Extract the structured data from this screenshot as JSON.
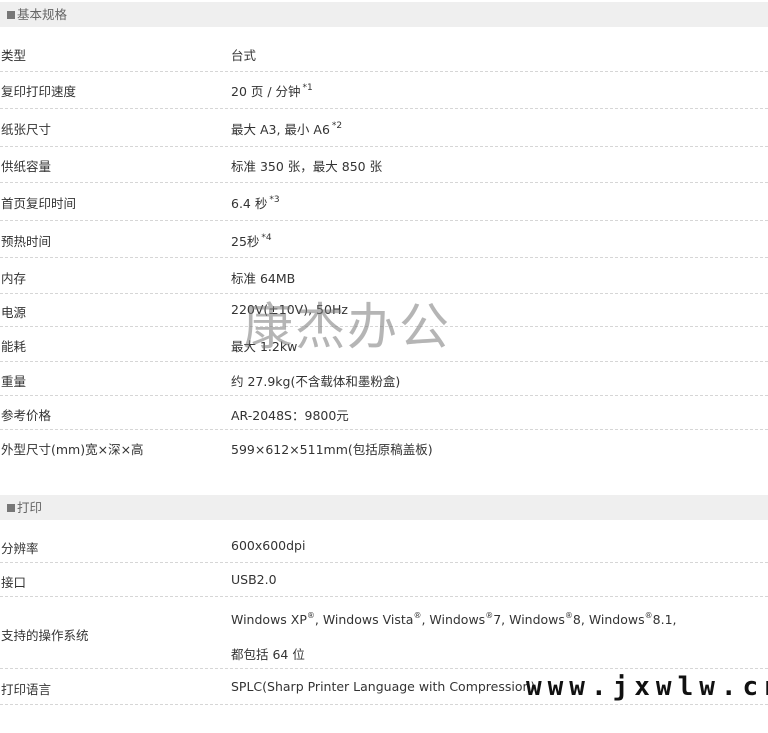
{
  "sections": [
    {
      "title": "基本规格",
      "rows": [
        {
          "label": "类型",
          "value": "台式"
        },
        {
          "label": "复印打印速度",
          "value": "20 页 / 分钟",
          "note": "*1"
        },
        {
          "label": "纸张尺寸",
          "value": "最大 A3, 最小 A6",
          "note": "*2"
        },
        {
          "label": "供纸容量",
          "value": "标准 350 张，最大 850 张"
        },
        {
          "label": "首页复印时间",
          "value": "6.4 秒",
          "note": "*3"
        },
        {
          "label": "预热时间",
          "value": "25秒",
          "note": "*4"
        },
        {
          "label": "内存",
          "value": "标准 64MB"
        },
        {
          "label": "电源",
          "value": "220V(±10V), 50Hz"
        },
        {
          "label": "能耗",
          "value": "最大 1.2kw"
        },
        {
          "label": "重量",
          "value": "约 27.9kg(不含载体和墨粉盒)"
        },
        {
          "label": "参考价格",
          "value": "AR-2048S：9800元"
        },
        {
          "label": "外型尺寸(mm)宽×深×高",
          "value": "599×612×511mm(包括原稿盖板)"
        }
      ]
    },
    {
      "title": "打印",
      "rows": [
        {
          "label": "分辨率",
          "value": "600x600dpi"
        },
        {
          "label": "接口",
          "value": "USB2.0"
        },
        {
          "label": "支持的操作系统",
          "os": [
            "Windows XP",
            "Windows Vista",
            "Windows",
            "Windows",
            "Windows"
          ],
          "os_suffix": [
            "",
            "",
            "7",
            "8",
            "8.1"
          ],
          "os_mark": "®",
          "line2": "都包括 64 位"
        },
        {
          "label": "打印语言",
          "value": "SPLC(Sharp Printer Language with Compression)"
        }
      ]
    }
  ],
  "watermarks": {
    "center": "康杰办公",
    "corner": "www.jxwlw.cn"
  }
}
